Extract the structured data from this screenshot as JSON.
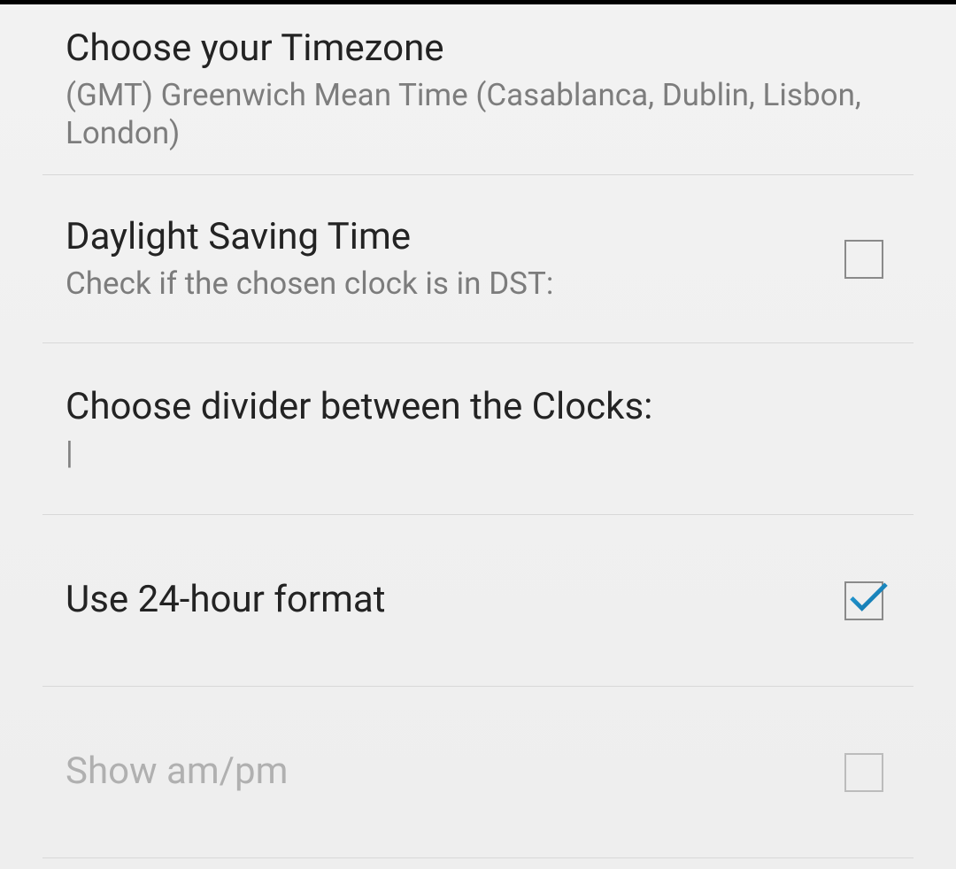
{
  "settings": {
    "timezone": {
      "title": "Choose your Timezone",
      "value": "(GMT) Greenwich Mean Time (Casablanca, Dublin, Lisbon, London)"
    },
    "dst": {
      "title": "Daylight Saving Time",
      "subtitle": "Check if the chosen clock is in DST:",
      "checked": false
    },
    "divider": {
      "title": "Choose divider between the Clocks:",
      "value": "|"
    },
    "format24": {
      "title": "Use 24-hour format",
      "checked": true
    },
    "ampm": {
      "title": "Show am/pm",
      "checked": false,
      "disabled": true
    }
  }
}
